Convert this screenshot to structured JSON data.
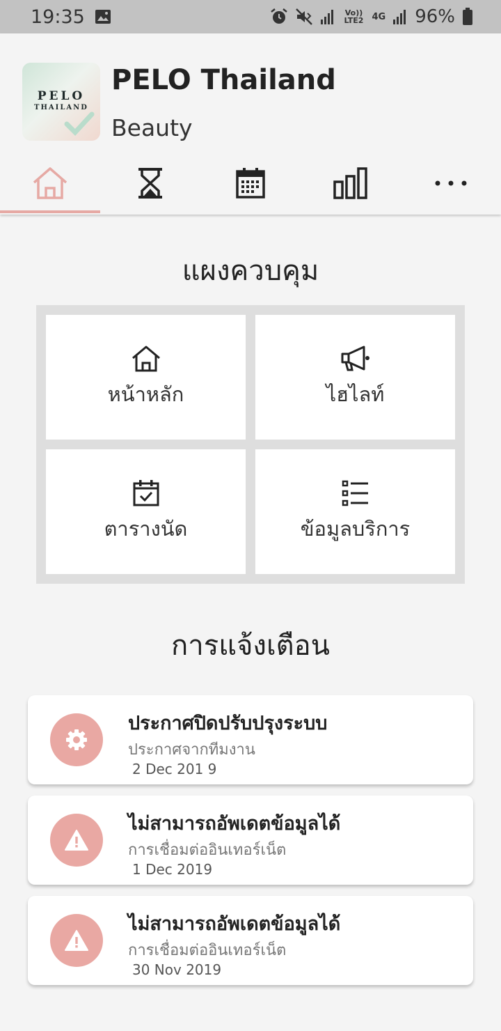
{
  "status_bar": {
    "time": "19:35",
    "network_small": "Vo)) LTE2",
    "network_type": "4G",
    "battery": "96%"
  },
  "header": {
    "logo_text_main": "PELO",
    "logo_text_sub": "THAILAND",
    "title": "PELO Thailand",
    "subtitle": "Beauty"
  },
  "tabs": [
    {
      "icon": "home-icon",
      "active": true
    },
    {
      "icon": "hourglass-icon",
      "active": false
    },
    {
      "icon": "calendar-icon",
      "active": false
    },
    {
      "icon": "bar-chart-icon",
      "active": false
    },
    {
      "icon": "more-icon",
      "active": false
    }
  ],
  "dashboard": {
    "title": "แผงควบคุม",
    "tiles": [
      {
        "icon": "home-icon",
        "label": "หน้าหลัก"
      },
      {
        "icon": "megaphone-icon",
        "label": "ไฮไลท์"
      },
      {
        "icon": "calendar-check-icon",
        "label": "ตารางนัด"
      },
      {
        "icon": "list-icon",
        "label": "ข้อมูลบริการ"
      }
    ]
  },
  "notifications": {
    "title": "การแจ้งเตือน",
    "items": [
      {
        "icon": "gear-icon",
        "title": "ประกาศปิดปรับปรุงระบบ",
        "subtitle": "ประกาศจากทีมงาน",
        "date": "2 Dec 201 9"
      },
      {
        "icon": "warning-icon",
        "title": "ไม่สามารถอัพเดตข้อมูลได้",
        "subtitle": "การเชื่อมต่ออินเทอร์เน็ต",
        "date": "1 Dec 2019"
      },
      {
        "icon": "warning-icon",
        "title": "ไม่สามารถอัพเดตข้อมูลได้",
        "subtitle": "การเชื่อมต่ออินเทอร์เน็ต",
        "date": "30 Nov 2019"
      }
    ]
  },
  "colors": {
    "accent": "#e6a9a4",
    "status_bar": "#c2c2c2",
    "background": "#f4f4f4"
  }
}
